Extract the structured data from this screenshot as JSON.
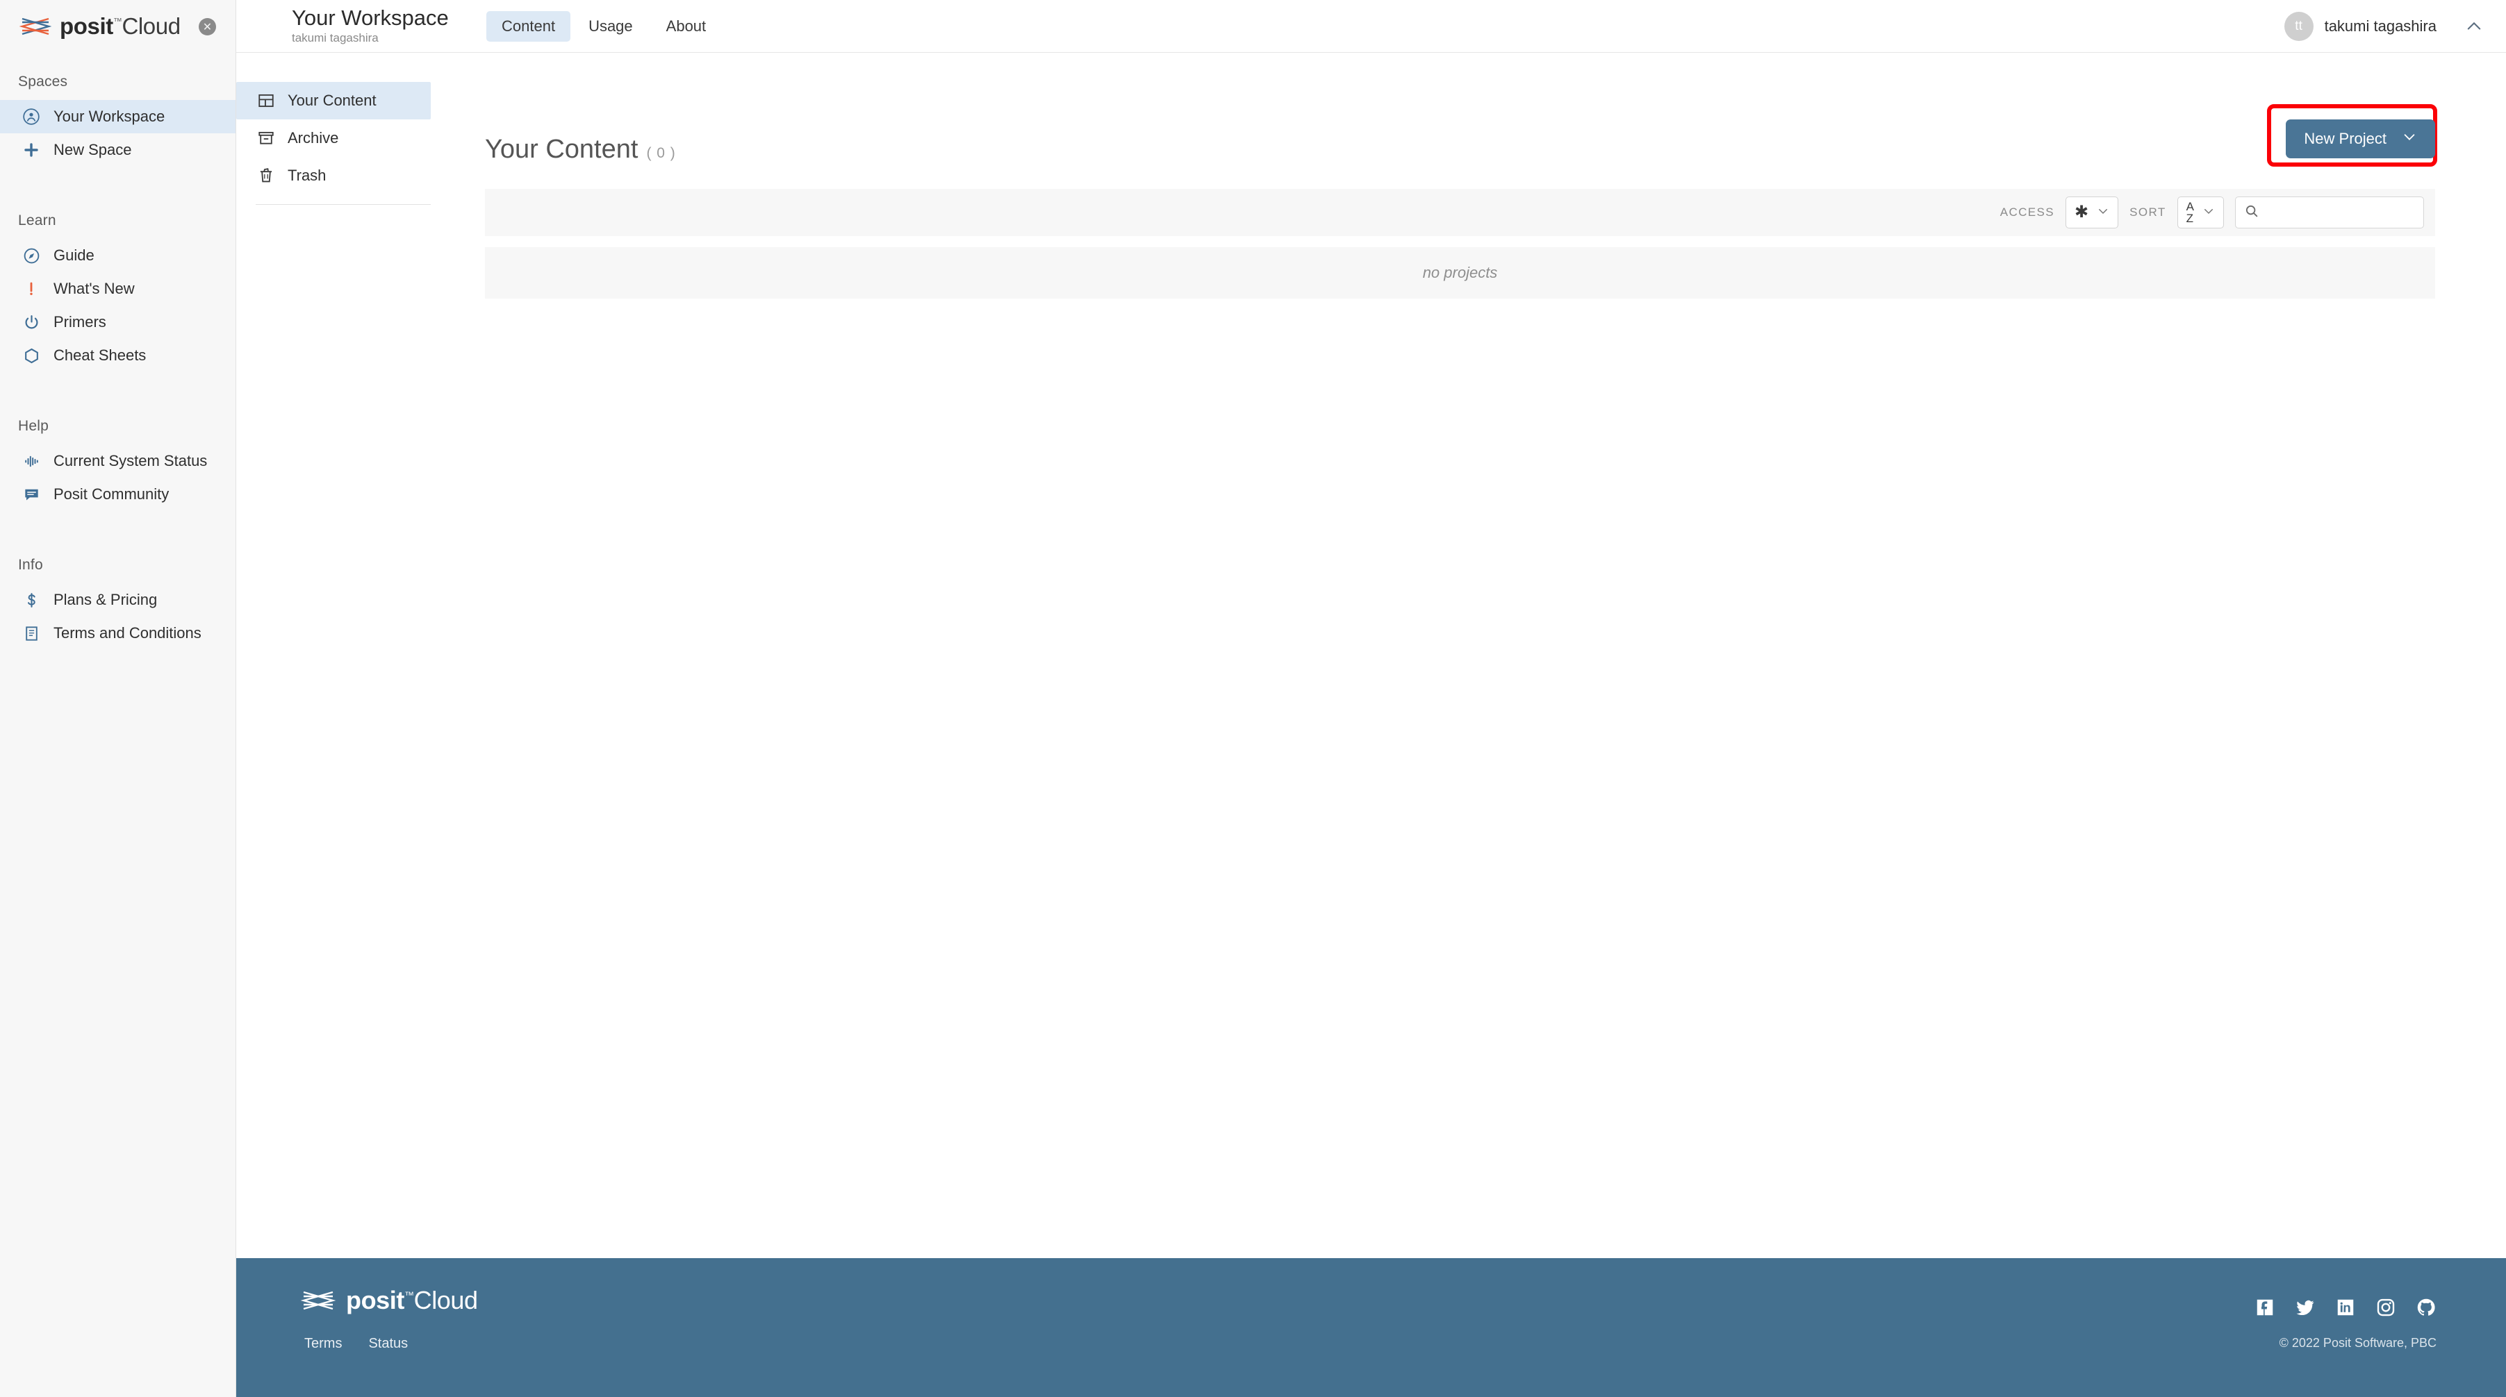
{
  "brand": {
    "name_bold": "posit",
    "tm": "™",
    "name_light": "Cloud",
    "close_glyph": "✕"
  },
  "sidebar": {
    "groups": [
      {
        "label": "Spaces",
        "items": [
          {
            "label": "Your Workspace",
            "icon": "user-circle-icon",
            "active": true
          },
          {
            "label": "New Space",
            "icon": "plus-icon",
            "active": false
          }
        ]
      },
      {
        "label": "Learn",
        "items": [
          {
            "label": "Guide",
            "icon": "compass-icon",
            "active": false
          },
          {
            "label": "What's New",
            "icon": "exclamation-icon",
            "active": false
          },
          {
            "label": "Primers",
            "icon": "power-icon",
            "active": false
          },
          {
            "label": "Cheat Sheets",
            "icon": "hexagon-icon",
            "active": false
          }
        ]
      },
      {
        "label": "Help",
        "items": [
          {
            "label": "Current System Status",
            "icon": "waveform-icon",
            "active": false
          },
          {
            "label": "Posit Community",
            "icon": "chat-icon",
            "active": false
          }
        ]
      },
      {
        "label": "Info",
        "items": [
          {
            "label": "Plans & Pricing",
            "icon": "dollar-icon",
            "active": false
          },
          {
            "label": "Terms and Conditions",
            "icon": "document-icon",
            "active": false
          }
        ]
      }
    ]
  },
  "topbar": {
    "workspace_title": "Your Workspace",
    "workspace_owner": "takumi tagashira",
    "tabs": [
      {
        "label": "Content",
        "active": true
      },
      {
        "label": "Usage",
        "active": false
      },
      {
        "label": "About",
        "active": false
      }
    ],
    "user_initials": "tt",
    "user_name": "takumi tagashira",
    "collapse_icon": "chevron-up-icon"
  },
  "content_nav": {
    "items": [
      {
        "label": "Your Content",
        "icon": "grid-icon",
        "active": true
      },
      {
        "label": "Archive",
        "icon": "archive-box-icon",
        "active": false
      },
      {
        "label": "Trash",
        "icon": "trash-icon",
        "active": false
      }
    ]
  },
  "main": {
    "page_title": "Your Content",
    "page_count": "( 0 )",
    "new_project_label": "New Project",
    "new_project_caret": "chevron-down-icon",
    "highlight_color": "#fb0007",
    "button_color": "#4a7596",
    "access_label": "ACCESS",
    "access_value": "✱",
    "sort_label": "SORT",
    "sort_value_top": "A",
    "sort_value_bottom": "Z",
    "search_placeholder": "",
    "search_value": "",
    "empty_message": "no projects"
  },
  "footer": {
    "name_bold": "posit",
    "tm": "™",
    "name_light": "Cloud",
    "links": [
      {
        "label": "Terms"
      },
      {
        "label": "Status"
      }
    ],
    "social": [
      {
        "name": "facebook-icon"
      },
      {
        "name": "twitter-icon"
      },
      {
        "name": "linkedin-icon"
      },
      {
        "name": "instagram-icon"
      },
      {
        "name": "github-icon"
      }
    ],
    "copyright": "© 2022 Posit Software, PBC",
    "background": "#44708f"
  }
}
